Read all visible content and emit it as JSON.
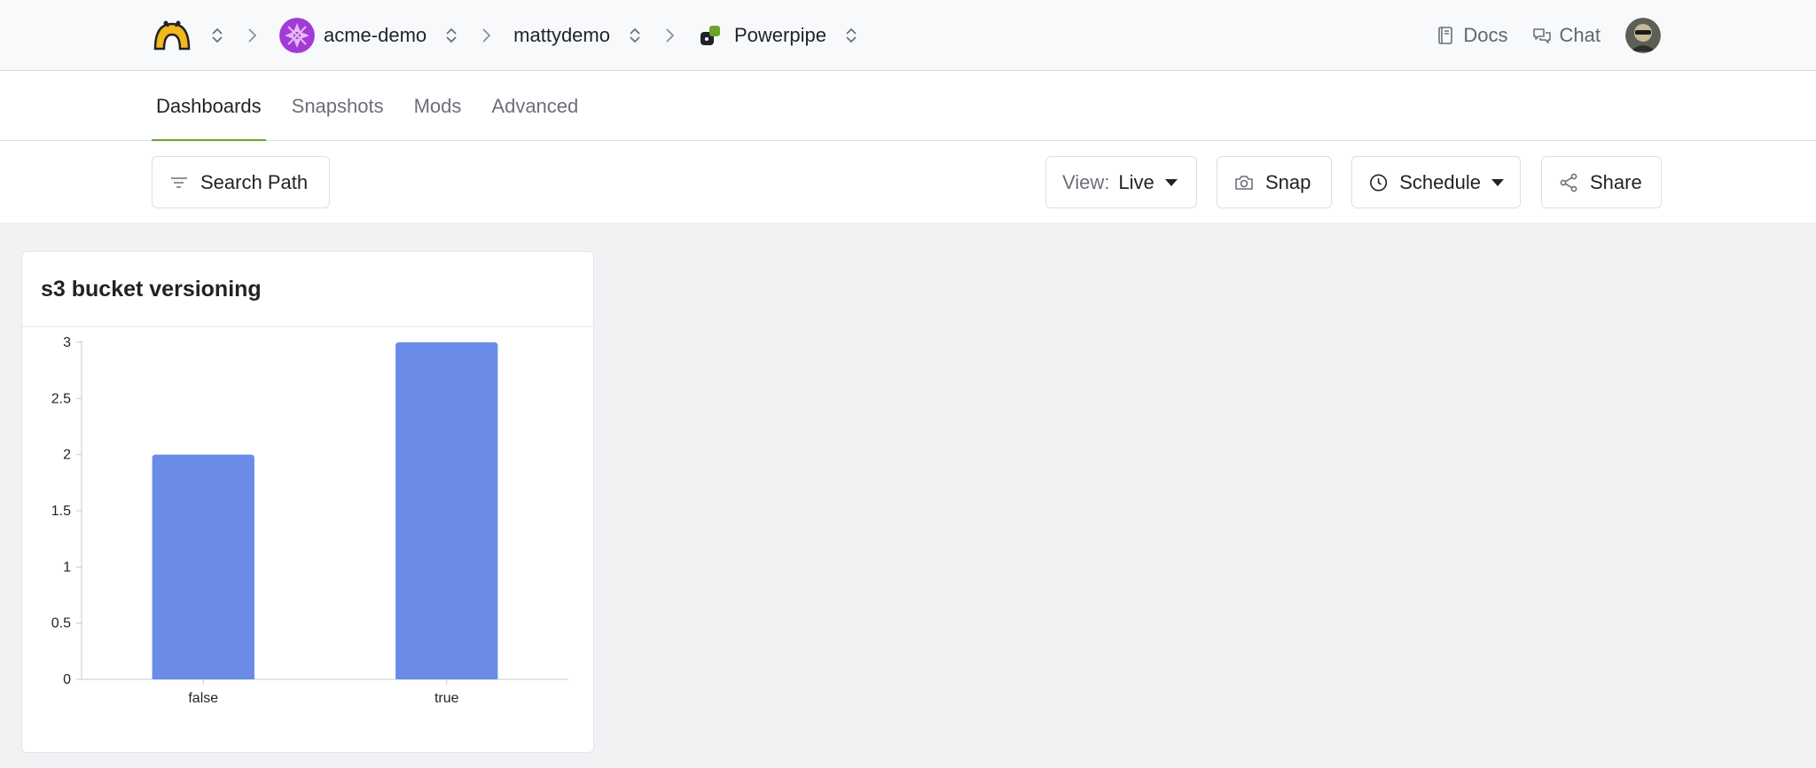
{
  "breadcrumbs": {
    "org_name": "acme-demo",
    "user_name": "mattydemo",
    "workspace_name": "Powerpipe"
  },
  "top_links": {
    "docs_label": "Docs",
    "chat_label": "Chat"
  },
  "tabs": [
    {
      "label": "Dashboards",
      "active": true
    },
    {
      "label": "Snapshots",
      "active": false
    },
    {
      "label": "Mods",
      "active": false
    },
    {
      "label": "Advanced",
      "active": false
    }
  ],
  "toolbar": {
    "search_path_label": "Search Path",
    "view_prefix": "View:",
    "view_value": "Live",
    "snap_label": "Snap",
    "schedule_label": "Schedule",
    "share_label": "Share"
  },
  "colors": {
    "accent": "#6da32a",
    "bar": "#6a8ce8",
    "logo": "#f2b81c",
    "org_avatar": "#a23bd6"
  },
  "panel": {
    "title": "s3 bucket versioning"
  },
  "chart_data": {
    "type": "bar",
    "categories": [
      "false",
      "true"
    ],
    "values": [
      2,
      3
    ],
    "title": "s3 bucket versioning",
    "xlabel": "",
    "ylabel": "",
    "ylim": [
      0,
      3
    ],
    "yticks": [
      "0",
      "0.5",
      "1",
      "1.5",
      "2",
      "2.5",
      "3"
    ],
    "grid": false
  }
}
